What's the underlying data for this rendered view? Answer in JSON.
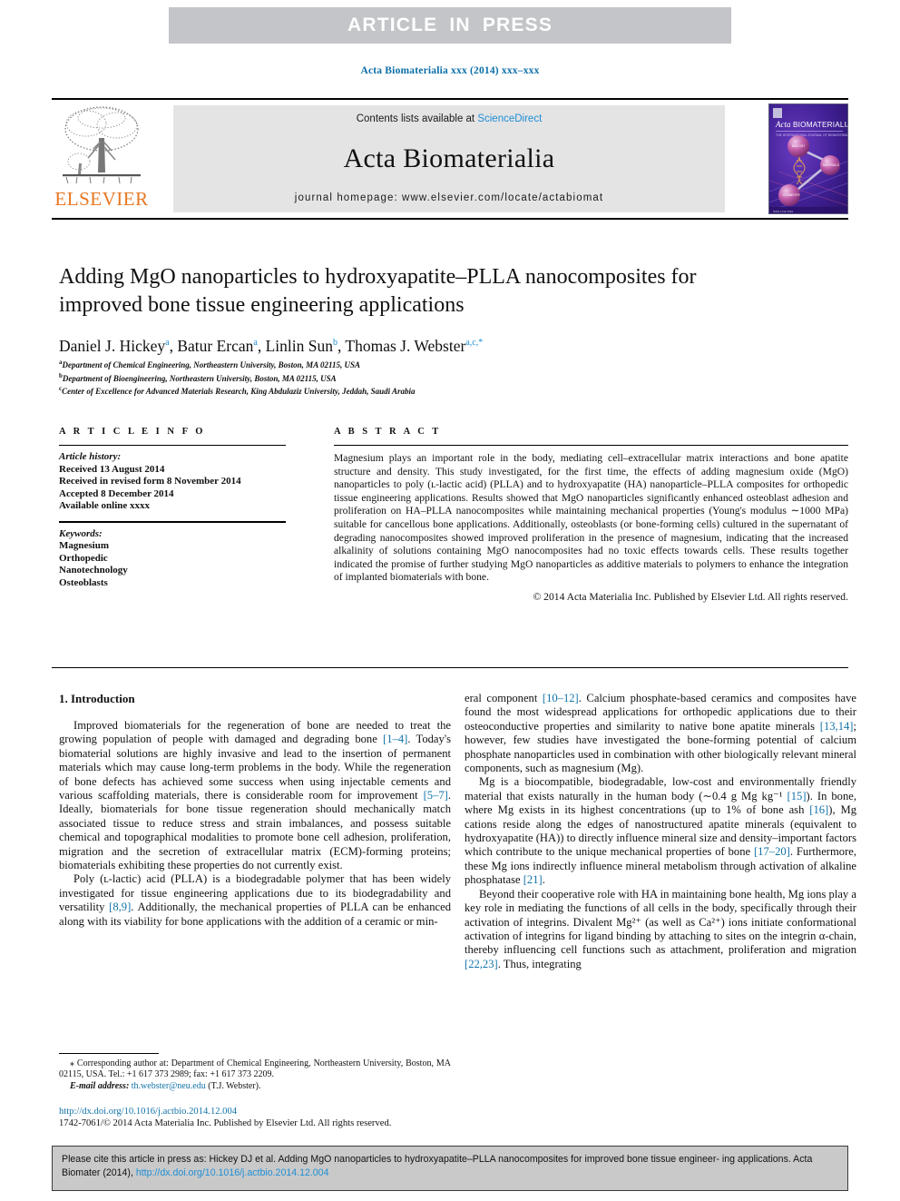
{
  "banner": {
    "text": "ARTICLE IN PRESS"
  },
  "running_head": "Acta Biomaterialia xxx (2014) xxx–xxx",
  "masthead": {
    "contents_prefix": "Contents lists available at ",
    "sciencedirect": "ScienceDirect",
    "journal_title": "Acta Biomaterialia",
    "homepage": "journal homepage: www.elsevier.com/locate/actabiomat",
    "publisher_logo_word": "ELSEVIER",
    "cover_title": "Acta BIOMATERIALIA"
  },
  "article": {
    "title": "Adding MgO nanoparticles to hydroxyapatite–PLLA nanocomposites for improved bone tissue engineering applications",
    "authors_html": "Daniel J. Hickey<sup>a</sup>, Batur Ercan<sup>a</sup>, Linlin Sun<sup>b</sup>, Thomas J. Webster<sup>a,c,</sup><sup>*</sup>",
    "affiliations": [
      "Department of Chemical Engineering, Northeastern University, Boston, MA 02115, USA",
      "Department of Bioengineering, Northeastern University, Boston, MA 02115, USA",
      "Center of Excellence for Advanced Materials Research, King Abdulaziz University, Jeddah, Saudi Arabia"
    ],
    "affiliation_marks": [
      "a",
      "b",
      "c"
    ]
  },
  "info": {
    "heading": "A R T I C L E    I N F O",
    "history_label": "Article history:",
    "history": [
      "Received 13 August 2014",
      "Received in revised form 8 November 2014",
      "Accepted 8 December 2014",
      "Available online xxxx"
    ],
    "keywords_label": "Keywords:",
    "keywords": [
      "Magnesium",
      "Orthopedic",
      "Nanotechnology",
      "Osteoblasts"
    ]
  },
  "abstract": {
    "heading": "A B S T R A C T",
    "text": "Magnesium plays an important role in the body, mediating cell–extracellular matrix interactions and bone apatite structure and density. This study investigated, for the first time, the effects of adding magnesium oxide (MgO) nanoparticles to poly (ʟ-lactic acid) (PLLA) and to hydroxyapatite (HA) nanoparticle–PLLA composites for orthopedic tissue engineering applications. Results showed that MgO nanoparticles significantly enhanced osteoblast adhesion and proliferation on HA–PLLA nanocomposites while maintaining mechanical properties (Young's modulus ∼1000 MPa) suitable for cancellous bone applications. Additionally, osteoblasts (or bone-forming cells) cultured in the supernatant of degrading nanocomposites showed improved proliferation in the presence of magnesium, indicating that the increased alkalinity of solutions containing MgO nanocomposites had no toxic effects towards cells. These results together indicated the promise of further studying MgO nanoparticles as additive materials to polymers to enhance the integration of implanted biomaterials with bone.",
    "copyright": "© 2014 Acta Materialia Inc. Published by Elsevier Ltd. All rights reserved."
  },
  "body": {
    "section_heading": "1. Introduction",
    "left_paragraphs": [
      "Improved biomaterials for the regeneration of bone are needed to treat the growing population of people with damaged and degrading bone [1–4]. Today's biomaterial solutions are highly invasive and lead to the insertion of permanent materials which may cause long-term problems in the body. While the regeneration of bone defects has achieved some success when using injectable cements and various scaffolding materials, there is considerable room for improvement [5–7]. Ideally, biomaterials for bone tissue regeneration should mechanically match associated tissue to reduce stress and strain imbalances, and possess suitable chemical and topographical modalities to promote bone cell adhesion, proliferation, migration and the secretion of extracellular matrix (ECM)-forming proteins; biomaterials exhibiting these properties do not currently exist.",
      "Poly (ʟ-lactic) acid (PLLA) is a biodegradable polymer that has been widely investigated for tissue engineering applications due to its biodegradability and versatility [8,9]. Additionally, the mechanical properties of PLLA can be enhanced along with its viability for bone applications with the addition of a ceramic or min-"
    ],
    "right_paragraphs": [
      "eral component [10–12]. Calcium phosphate-based ceramics and composites have found the most widespread applications for orthopedic applications due to their osteoconductive properties and similarity to native bone apatite minerals [13,14]; however, few studies have investigated the bone-forming potential of calcium phosphate nanoparticles used in combination with other biologically relevant mineral components, such as magnesium (Mg).",
      "Mg is a biocompatible, biodegradable, low-cost and environmentally friendly material that exists naturally in the human body (∼0.4 g Mg kg⁻¹ [15]). In bone, where Mg exists in its highest concentrations (up to 1% of bone ash [16]), Mg cations reside along the edges of nanostructured apatite minerals (equivalent to hydroxyapatite (HA)) to directly influence mineral size and density–important factors which contribute to the unique mechanical properties of bone [17–20]. Furthermore, these Mg ions indirectly influence mineral metabolism through activation of alkaline phosphatase [21].",
      "Beyond their cooperative role with HA in maintaining bone health, Mg ions play a key role in mediating the functions of all cells in the body, specifically through their activation of integrins. Divalent Mg²⁺ (as well as Ca²⁺) ions initiate conformational activation of integrins for ligand binding by attaching to sites on the integrin α-chain, thereby influencing cell functions such as attachment, proliferation and migration [22,23]. Thus, integrating"
    ]
  },
  "footnote": {
    "marker": "⁎",
    "text": "Corresponding author at: Department of Chemical Engineering, Northeastern University, Boston, MA 02115, USA. Tel.: +1 617 373 2989; fax: +1 617 373 2209.",
    "email_label": "E-mail address:",
    "email": "th.webster@neu.edu",
    "email_owner": "(T.J. Webster)."
  },
  "doi_block": {
    "doi_url": "http://dx.doi.org/10.1016/j.actbio.2014.12.004",
    "issn_line": "1742-7061/© 2014 Acta Materialia Inc. Published by Elsevier Ltd. All rights reserved."
  },
  "cite_box": {
    "line1": "Please cite this article in press as: Hickey DJ et al. Adding MgO nanoparticles to hydroxyapatite–PLLA nanocomposites for improved bone tissue engineer-",
    "line2_prefix": "ing applications. Acta Biomater (2014), ",
    "line2_link": "http://dx.doi.org/10.1016/j.actbio.2014.12.004"
  },
  "colors": {
    "banner_bg": "#c3c5c8",
    "link_blue": "#1273a8",
    "sciencedirect_blue": "#1e8fd5",
    "elsevier_orange": "#e87722",
    "masthead_gray": "#e4e4e4",
    "cite_gray": "#c9c9c9"
  }
}
